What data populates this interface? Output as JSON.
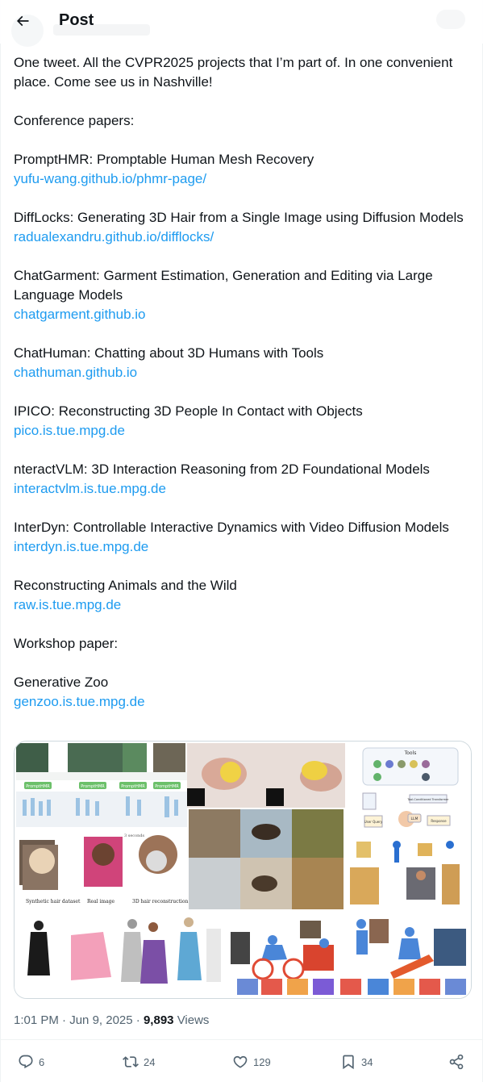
{
  "header": {
    "title": "Post",
    "back_icon": "arrow-left-icon"
  },
  "tweet": {
    "lines": [
      "One tweet. All the CVPR2025 projects that I’m part of. In one convenient place. Come see us in Nashville!",
      "Conference papers:",
      "PromptHMR: Promptable Human Mesh Recovery",
      "DiffLocks: Generating 3D Hair from a Single Image using Diffusion Models",
      "ChatGarment: Garment Estimation, Generation and Editing via Large Language Models",
      "ChatHuman: Chatting about 3D Humans with Tools",
      "IPICO: Reconstructing 3D People In Contact with Objects",
      "nteractVLM: 3D Interaction Reasoning from 2D Foundational Models",
      "InterDyn: Controllable Interactive Dynamics with Video Diffusion Models",
      "Reconstructing Animals and the Wild",
      "Workshop paper:",
      "Generative Zoo"
    ],
    "links": [
      "yufu-wang.github.io/phmr-page/",
      "radualexandru.github.io/difflocks/",
      "chatgarment.github.io",
      "chathuman.github.io",
      "pico.is.tue.mpg.de",
      "interactvlm.is.tue.mpg.de",
      "interdyn.is.tue.mpg.de",
      "raw.is.tue.mpg.de",
      "genzoo.is.tue.mpg.de"
    ]
  },
  "media": {
    "prompthmr_badge": "PromptHMR",
    "chathuman": {
      "tools_title": "Tools",
      "user_query": "User Query",
      "llm": "LLM",
      "response": "Response",
      "tool_label": "Tool-Conditioned Transformer"
    },
    "hair_captions": [
      "Synthetic hair dataset",
      "Real image",
      "3D hair reconstruction"
    ],
    "hair_arrow": "3 seconds"
  },
  "meta": {
    "time": "1:01 PM",
    "sep": "·",
    "date": "Jun 9, 2025",
    "views_count": "9,893",
    "views_label": "Views"
  },
  "actions": {
    "replies": "6",
    "reposts": "24",
    "likes": "129",
    "bookmarks": "34"
  },
  "colors": {
    "link": "#1d9bf0",
    "text": "#0f1419",
    "muted": "#536471",
    "border": "#cfd9de"
  }
}
